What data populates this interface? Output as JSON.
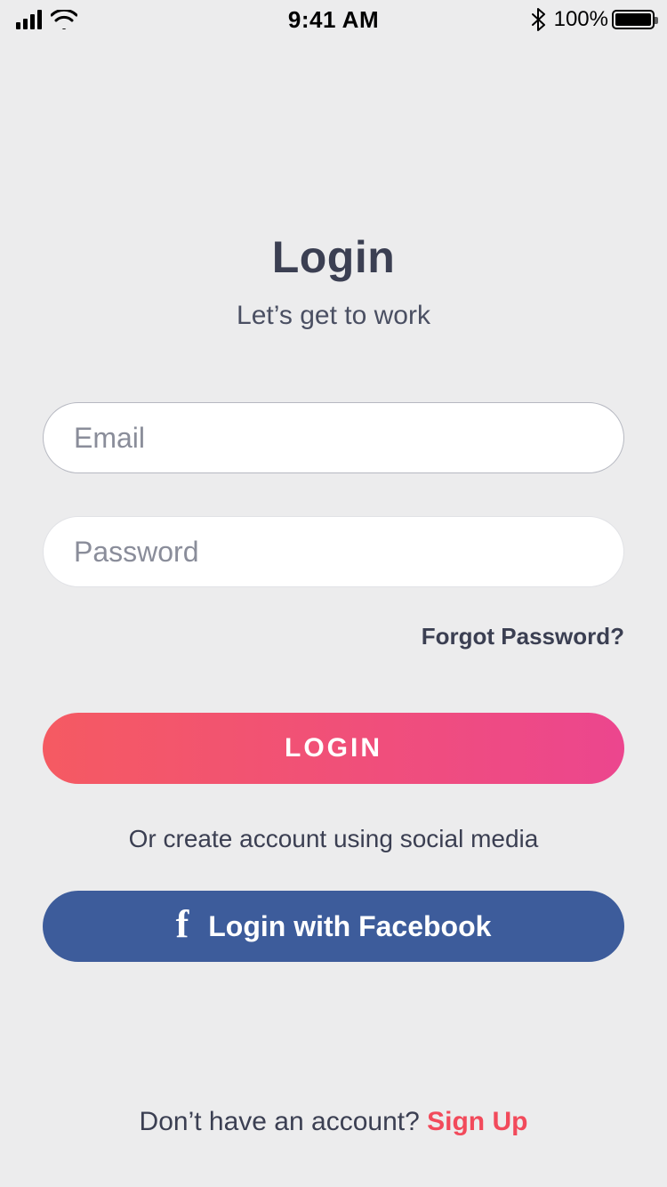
{
  "statusbar": {
    "time": "9:41 AM",
    "battery_pct": "100%"
  },
  "login": {
    "title": "Login",
    "subtitle": "Let’s get to work",
    "email_placeholder": "Email",
    "password_placeholder": "Password",
    "forgot": "Forgot Password?",
    "login_button": "LOGIN",
    "social_hint": "Or create account using social media",
    "facebook_button": "Login with Facebook",
    "signup_prompt": "Don’t have an account? ",
    "signup_link": "Sign Up"
  }
}
